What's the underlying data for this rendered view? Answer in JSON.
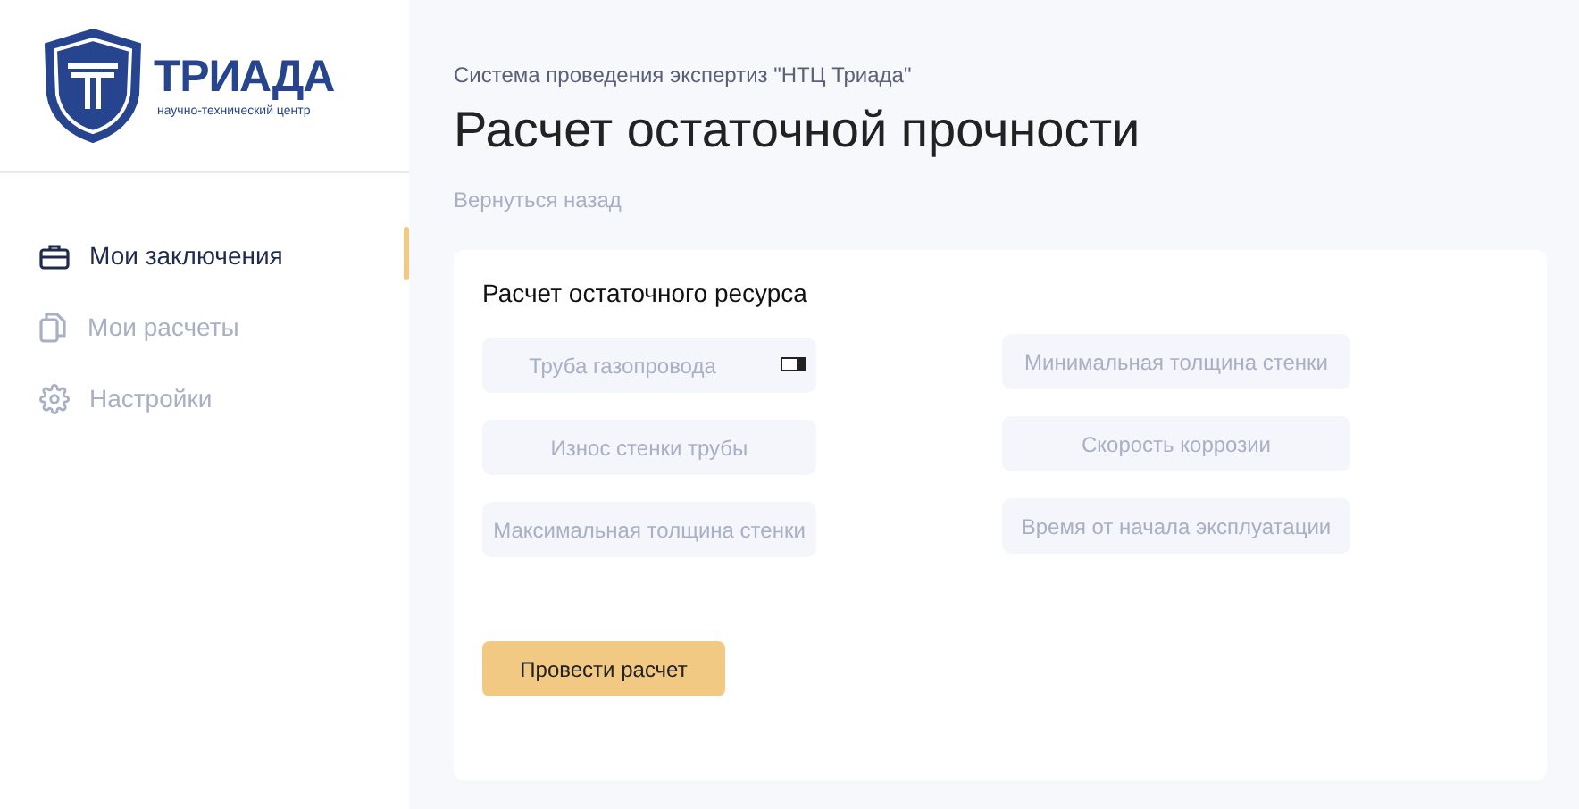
{
  "logo": {
    "name": "ТРИАДА",
    "subtitle": "научно-технический центр"
  },
  "sidebar": {
    "items": [
      {
        "label": "Мои заключения",
        "kind": "briefcase",
        "selected": true
      },
      {
        "label": "Мои расчеты",
        "kind": "files",
        "selected": false
      },
      {
        "label": "Настройки",
        "kind": "gear",
        "selected": false
      }
    ]
  },
  "header": {
    "system": "Система проведения экспертиз \"НТЦ Триада\"",
    "title": "Расчет остаточной прочности",
    "back": "Вернуться назад"
  },
  "form": {
    "title": "Расчет остаточного ресурса",
    "columns": [
      [
        {
          "placeholder": "Труба газопровода",
          "kind": "select"
        },
        {
          "placeholder": "Износ стенки трубы",
          "kind": "text"
        },
        {
          "placeholder": "Максимальная толщина стенки",
          "kind": "text"
        }
      ],
      [
        {
          "placeholder": "Минимальная толщина стенки",
          "kind": "text"
        },
        {
          "placeholder": "Скорость коррозии",
          "kind": "text"
        },
        {
          "placeholder": "Время от начала эксплуатации",
          "kind": "text"
        }
      ]
    ],
    "button": "Провести расчет"
  }
}
